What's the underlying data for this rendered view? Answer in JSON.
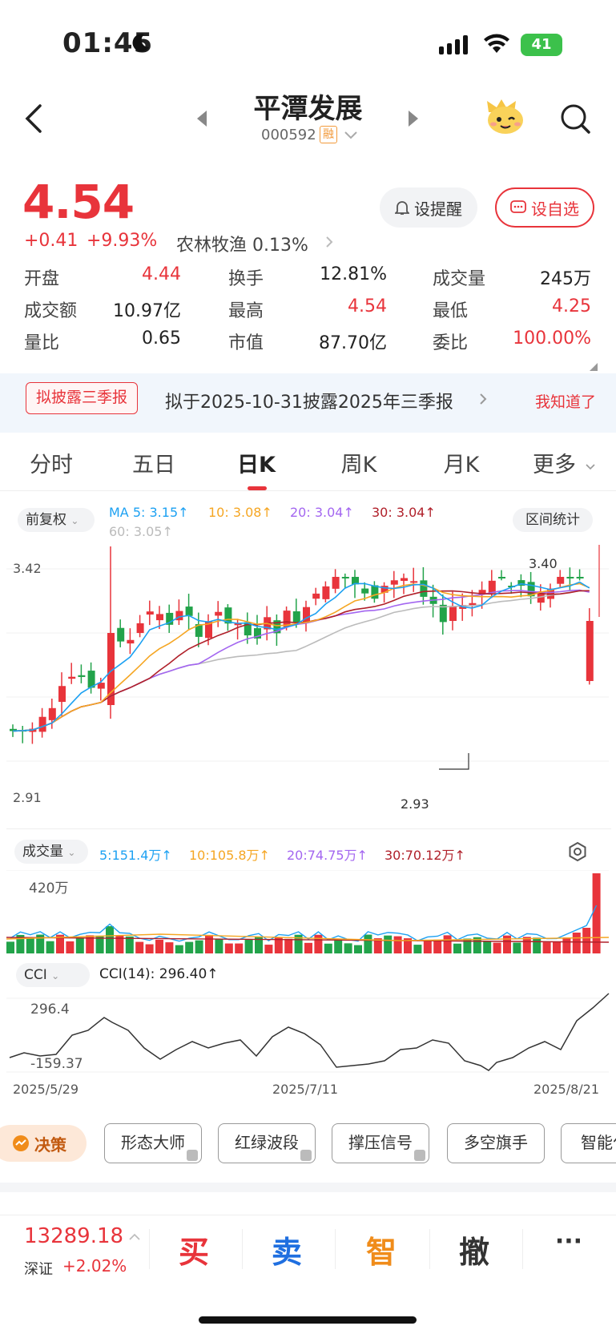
{
  "status": {
    "time": "01:45",
    "battery": "41"
  },
  "header": {
    "title": "平潭发展",
    "code": "000592",
    "margin_badge": "融"
  },
  "quote": {
    "price": "4.54",
    "change": "+0.41",
    "change_pct": "+9.93%",
    "sector": "农林牧渔 0.13%",
    "alert_btn": "设提醒",
    "watch_btn": "设自选",
    "fields": [
      {
        "label": "开盘",
        "value": "4.44",
        "color": "#e8343b"
      },
      {
        "label": "换手",
        "value": "12.81%",
        "color": "#222222"
      },
      {
        "label": "成交量",
        "value": "245万",
        "color": "#222222"
      },
      {
        "label": "成交额",
        "value": "10.97亿",
        "color": "#222222"
      },
      {
        "label": "最高",
        "value": "4.54",
        "color": "#e8343b"
      },
      {
        "label": "最低",
        "value": "4.25",
        "color": "#e8343b"
      },
      {
        "label": "量比",
        "value": "0.65",
        "color": "#222222"
      },
      {
        "label": "市值",
        "value": "87.70亿",
        "color": "#222222"
      },
      {
        "label": "委比",
        "value": "100.00%",
        "color": "#e8343b"
      }
    ]
  },
  "notice": {
    "tag": "拟披露三季报",
    "text": "拟于2025-10-31披露2025年三季报",
    "dismiss": "我知道了"
  },
  "tabs": [
    "分时",
    "五日",
    "日K",
    "周K",
    "月K",
    "更多"
  ],
  "kline": {
    "adjust": "前复权",
    "interval_stats": "区间统计",
    "ma": [
      {
        "label": "MA 5: 3.15↑",
        "color": "#1da1f2"
      },
      {
        "label": "10: 3.08↑",
        "color": "#f5a623"
      },
      {
        "label": "20: 3.04↑",
        "color": "#a366f0"
      },
      {
        "label": "30: 3.04↑",
        "color": "#b0202a"
      },
      {
        "label": "60: 3.05↑",
        "color": "#bbbbbb"
      }
    ],
    "y_top": "3.42",
    "y_bottom": "2.91",
    "high_label": "3.40",
    "low_label": "2.93"
  },
  "volume": {
    "label": "成交量",
    "ma": [
      {
        "label": "5:151.4万↑",
        "color": "#1da1f2"
      },
      {
        "label": "10:105.8万↑",
        "color": "#f5a623"
      },
      {
        "label": "20:74.75万↑",
        "color": "#a366f0"
      },
      {
        "label": "30:70.12万↑",
        "color": "#b0202a"
      }
    ],
    "max_label": "420万"
  },
  "cci": {
    "label": "CCI",
    "value": "CCI(14): 296.40↑",
    "top": "296.4",
    "bottom": "-159.37"
  },
  "dates": [
    "2025/5/29",
    "2025/7/11",
    "2025/8/21"
  ],
  "tools": {
    "decision": "决策",
    "items": [
      "形态大师",
      "红绿波段",
      "撑压信号",
      "多空旗手",
      "智能化"
    ]
  },
  "bottom": {
    "index_value": "13289.18",
    "index_name": "深证",
    "index_change": "+2.02%",
    "buy": "买",
    "sell": "卖",
    "smart": "智",
    "cancel": "撤",
    "more": "···"
  }
}
